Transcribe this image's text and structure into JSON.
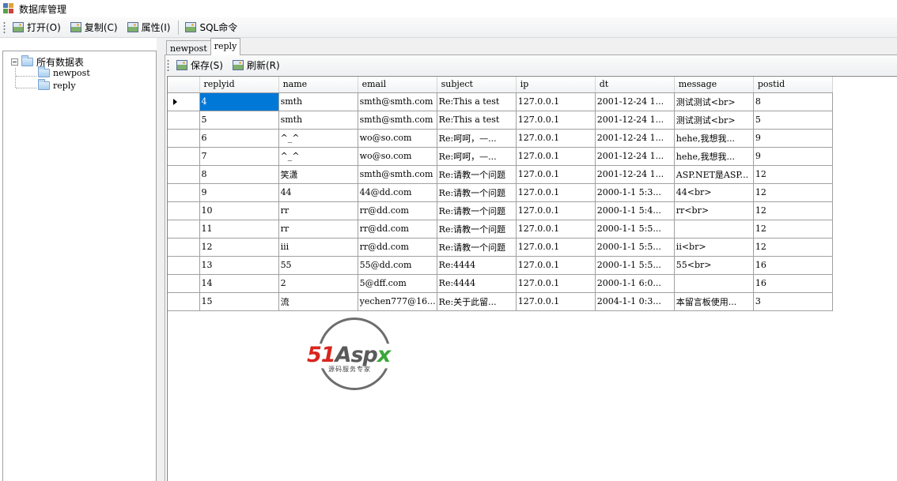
{
  "window": {
    "title": "数据库管理"
  },
  "toolbar": {
    "open_label": "打开(O)",
    "copy_label": "复制(C)",
    "properties_label": "属性(I)",
    "sql_label": "SQL命令"
  },
  "tree": {
    "root_label": "所有数据表",
    "items": [
      {
        "label": "newpost"
      },
      {
        "label": "reply"
      }
    ]
  },
  "tabs": [
    {
      "label": "newpost",
      "active": false
    },
    {
      "label": "reply",
      "active": true
    }
  ],
  "subtoolbar": {
    "save_label": "保存(S)",
    "refresh_label": "刷新(R)"
  },
  "grid": {
    "columns": [
      "replyid",
      "name",
      "email",
      "subject",
      "ip",
      "dt",
      "message",
      "postid"
    ],
    "rows": [
      [
        "4",
        "smth",
        "smth@smth.com",
        "Re:This a test",
        "127.0.0.1",
        "2001-12-24 1...",
        "测试测试<br>",
        "8"
      ],
      [
        "5",
        "smth",
        "smth@smth.com",
        "Re:This a test",
        "127.0.0.1",
        "2001-12-24 1...",
        "测试测试<br>",
        "5"
      ],
      [
        "6",
        "^_^",
        "wo@so.com",
        "Re:呵呵，—...",
        "127.0.0.1",
        "2001-12-24 1...",
        "hehe,我想我...",
        "9"
      ],
      [
        "7",
        "^_^",
        "wo@so.com",
        "Re:呵呵，—...",
        "127.0.0.1",
        "2001-12-24 1...",
        "hehe,我想我...",
        "9"
      ],
      [
        "8",
        "笑潇",
        "smth@smth.com",
        "Re:请教一个问题",
        "127.0.0.1",
        "2001-12-24 1...",
        "ASP.NET是ASP...",
        "12"
      ],
      [
        "9",
        "44",
        "44@dd.com",
        "Re:请教一个问题",
        "127.0.0.1",
        "2000-1-1 5:3...",
        "44<br>",
        "12"
      ],
      [
        "10",
        "rr",
        "rr@dd.com",
        "Re:请教一个问题",
        "127.0.0.1",
        "2000-1-1 5:4...",
        "rr<br>",
        "12"
      ],
      [
        "11",
        "rr",
        "rr@dd.com",
        "Re:请教一个问题",
        "127.0.0.1",
        "2000-1-1 5:5...",
        "",
        "12"
      ],
      [
        "12",
        "iii",
        "rr@dd.com",
        "Re:请教一个问题",
        "127.0.0.1",
        "2000-1-1 5:5...",
        "ii<br>",
        "12"
      ],
      [
        "13",
        "55",
        "55@dd.com",
        "Re:4444",
        "127.0.0.1",
        "2000-1-1 5:5...",
        "55<br>",
        "16"
      ],
      [
        "14",
        "2",
        "5@dff.com",
        "Re:4444",
        "127.0.0.1",
        "2000-1-1 6:0...",
        "",
        "16"
      ],
      [
        "15",
        "流",
        "yechen777@16...",
        "Re:关于此留...",
        "127.0.0.1",
        "2004-1-1 0:3...",
        "本留言板使用...",
        "3"
      ]
    ],
    "current_row": 0,
    "selected_cell": 0
  },
  "watermark": {
    "brand_51": "51",
    "brand_asp": "Asp",
    "brand_x": "x",
    "tagline": "源码服务专家"
  },
  "colors": {
    "selection": "#0078d7",
    "accent_red": "#d7261e",
    "accent_green": "#3aa63a"
  },
  "icons": {
    "toolbar_button": "image-icon",
    "tree_node": "folder-icon",
    "row_indicator": "current-row-arrow-icon"
  }
}
